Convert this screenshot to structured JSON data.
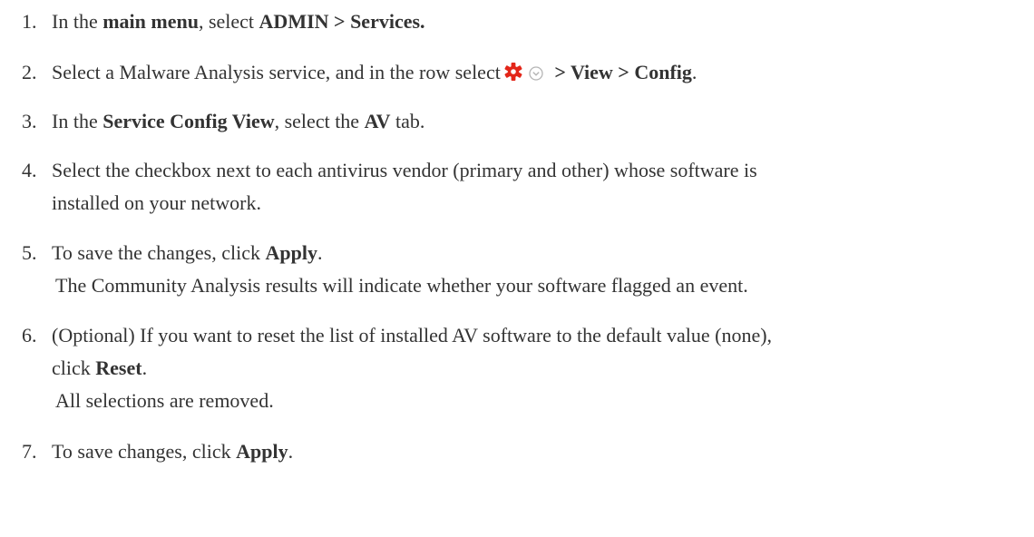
{
  "steps": [
    {
      "number": "1.",
      "t1": "In the ",
      "b1": "main menu",
      "t2": ", select ",
      "b2": "ADMIN > Services."
    },
    {
      "number": "2.",
      "t1": "Select a Malware Analysis service, and in the row select",
      "b1": " > View > Config",
      "t2": ".",
      "icons": [
        "gear-icon",
        "chevron-down-circle-icon"
      ],
      "icon_colors": {
        "gear": "#e32619",
        "chevron": "#b5b5b5"
      }
    },
    {
      "number": "3.",
      "t1": "In the ",
      "b1": "Service Config View",
      "t2": ", select the ",
      "b2": "AV",
      "t3": " tab."
    },
    {
      "number": "4.",
      "line1": "Select the checkbox next to each antivirus vendor (primary and other) whose software is",
      "line2": "installed on your network."
    },
    {
      "number": "5.",
      "t1": "To save the changes, click ",
      "b1": "Apply",
      "t2": ".",
      "note": "The Community Analysis results will indicate whether your software flagged an event."
    },
    {
      "number": "6.",
      "line1": "(Optional) If you want to reset the list of installed AV software to the default value (none),",
      "t1": "click ",
      "b1": "Reset",
      "t2": ".",
      "note": "All selections are removed."
    },
    {
      "number": "7.",
      "t1": "To save changes, click ",
      "b1": "Apply",
      "t2": "."
    }
  ]
}
